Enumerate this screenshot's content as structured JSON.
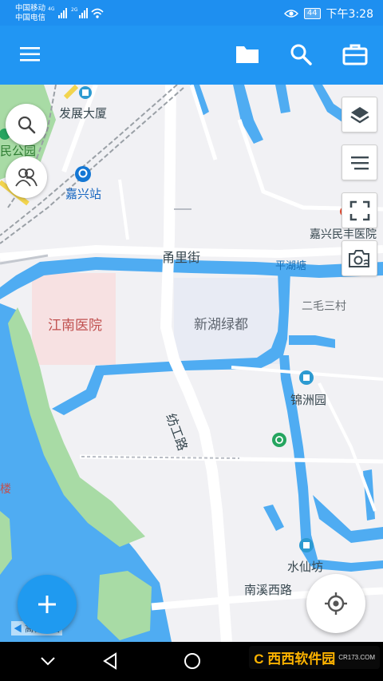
{
  "status_bar": {
    "carrier_1": "中国移动",
    "carrier_2": "中国电信",
    "net_1": "4G",
    "net_2": "2G",
    "battery": "44",
    "time": "下午3:28"
  },
  "map": {
    "labels": {
      "fazhan": "发展大厦",
      "park": "民公园",
      "jiaxing_station": "嘉兴站",
      "yongli_street": "甬里街",
      "jiaxing_hospital": "嘉兴民丰医院",
      "pinghu_pond": "平湖塘",
      "ermao": "二毛三村",
      "jiangnan_hospital": "江南医院",
      "xinhu": "新湖绿都",
      "jinzhou": "锦洲园",
      "fanggong_road": "纺工路",
      "shuixianfang": "水仙坊",
      "nanxi_road": "南溪西路",
      "lou": "楼",
      "map_logo": "高德地图"
    }
  },
  "colors": {
    "accent": "#2196f3",
    "water": "#4facf2",
    "green": "#a8dba5",
    "road": "#ffffff",
    "land": "#f1f1f4"
  }
}
